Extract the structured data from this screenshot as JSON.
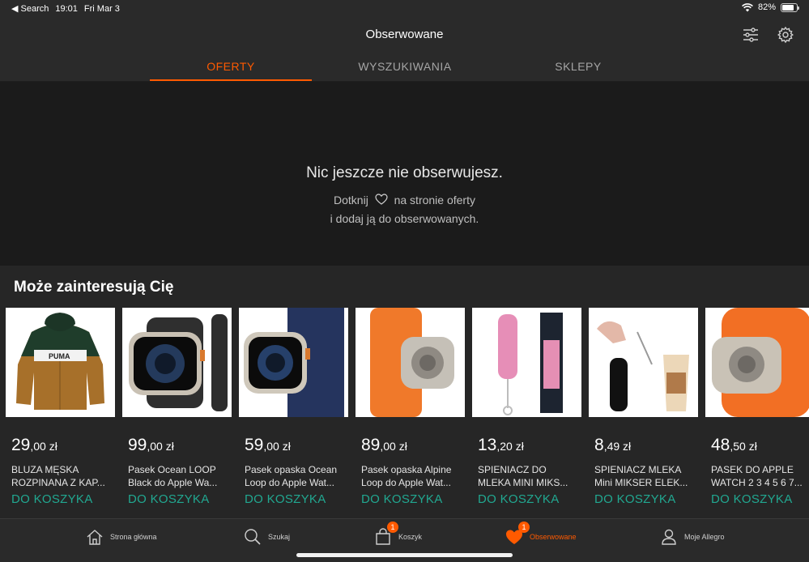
{
  "status_bar": {
    "back": "◀ Search",
    "time": "19:01",
    "date": "Fri Mar 3",
    "battery": "82%",
    "battery_level": 0.82
  },
  "header": {
    "title": "Obserwowane",
    "filter_icon": "sliders-icon",
    "settings_icon": "gear-icon"
  },
  "tabs": [
    {
      "label": "OFERTY",
      "active": true
    },
    {
      "label": "WYSZUKIWANIA",
      "active": false
    },
    {
      "label": "SKLEPY",
      "active": false
    }
  ],
  "empty_state": {
    "heading": "Nic jeszcze nie obserwujesz.",
    "line1_before": "Dotknij",
    "line1_after": "na stronie oferty",
    "line2": "i dodaj ją do obserwowanych."
  },
  "recommendations": {
    "title": "Może zainteresują Cię",
    "items": [
      {
        "price_main": "29",
        "price_frac": ",00 zł",
        "name1": "BLUZA MĘSKA",
        "name2": "ROZPINANA Z KAP...",
        "cart": "DO KOSZYKA",
        "image": "hoodie"
      },
      {
        "price_main": "99",
        "price_frac": ",00 zł",
        "name1": "Pasek Ocean LOOP",
        "name2": "Black do Apple Wa...",
        "cart": "DO KOSZYKA",
        "image": "watch-black"
      },
      {
        "price_main": "59",
        "price_frac": ",00 zł",
        "name1": "Pasek opaska Ocean",
        "name2": "Loop do Apple Wat...",
        "cart": "DO KOSZYKA",
        "image": "watch-navy"
      },
      {
        "price_main": "89",
        "price_frac": ",00 zł",
        "name1": "Pasek opaska Alpine",
        "name2": "Loop do Apple Wat...",
        "cart": "DO KOSZYKA",
        "image": "watch-orange"
      },
      {
        "price_main": "13",
        "price_frac": ",20 zł",
        "name1": "SPIENIACZ DO",
        "name2": "MLEKA MINI MIKS...",
        "cart": "DO KOSZYKA",
        "image": "frother-pink"
      },
      {
        "price_main": "8",
        "price_frac": ",49 zł",
        "name1": "SPIENIACZ MLEKA",
        "name2": "Mini MIKSER ELEK...",
        "cart": "DO KOSZYKA",
        "image": "frother-black"
      },
      {
        "price_main": "48",
        "price_frac": ",50 zł",
        "name1": "PASEK DO APPLE",
        "name2": "WATCH 2 3 4 5 6 7...",
        "cart": "DO KOSZYKA",
        "image": "watch-orange2"
      }
    ]
  },
  "tab_bar": [
    {
      "label": "Strona główna",
      "icon": "home-icon",
      "badge": "",
      "active": false
    },
    {
      "label": "Szukaj",
      "icon": "search-icon",
      "badge": "",
      "active": false
    },
    {
      "label": "Koszyk",
      "icon": "bag-icon",
      "badge": "1",
      "active": false
    },
    {
      "label": "Obserwowane",
      "icon": "heart-icon",
      "badge": "1",
      "active": true
    },
    {
      "label": "Moje Allegro",
      "icon": "user-icon",
      "badge": "",
      "active": false
    }
  ],
  "colors": {
    "accent": "#ff5a00",
    "cart_green": "#21a891",
    "background": "#1f1f1f"
  }
}
